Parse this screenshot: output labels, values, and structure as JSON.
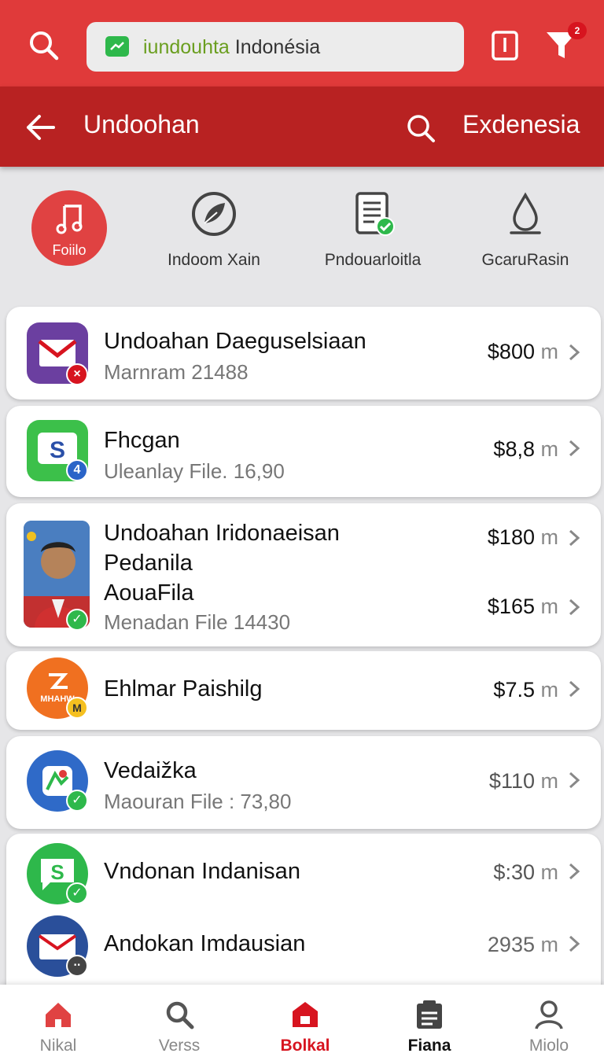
{
  "search": {
    "value_green": "iundouhta",
    "value_rest": " Indonésia"
  },
  "notifications": {
    "count": "2"
  },
  "header": {
    "title": "Undoohan",
    "action": "Exdenesia"
  },
  "categories": [
    {
      "label": "Foiilo",
      "icon": "music-note-icon",
      "active": true
    },
    {
      "label": "Indoom Xain",
      "icon": "leaf-circle-icon"
    },
    {
      "label": "Pndouarloitla",
      "icon": "document-check-icon"
    },
    {
      "label": "GcaruRasin",
      "icon": "droplet-icon"
    }
  ],
  "items": [
    {
      "title": "Undoahan Daeguselsiaan",
      "subtitle": "Marnram 21488",
      "price": "$800",
      "unit": "m",
      "icon": "mail-app-icon",
      "badge": "x"
    },
    {
      "title": "Fhcgan",
      "subtitle": "Uleanlay File. 16,90",
      "price": "$8,8",
      "unit": "m",
      "icon": "s-app-icon",
      "badge": "4"
    },
    {
      "title": "Undoahan Iridonaeisan",
      "title2": "Pedanila",
      "title3": "AouaFila",
      "subtitle": "Menadan File 14430",
      "price": "$180",
      "price2": "$165",
      "unit": "m",
      "icon": "profile-photo-icon",
      "badge": "check"
    },
    {
      "title": "Ehlmar Paishilg",
      "price": "$7.5",
      "unit": "m",
      "icon": "mhahw-app-icon",
      "badge": "M",
      "icon_text": "MHAHW"
    },
    {
      "title": "Vedaižka",
      "subtitle": "Maouran File : 73,80",
      "price": "$110",
      "unit": "m",
      "icon": "map-app-icon",
      "badge": "check"
    },
    {
      "title": "Vndonan Indanisan",
      "price": "$:30",
      "unit": "m",
      "icon": "message-s-app-icon",
      "badge": "check"
    },
    {
      "title": "Andokan Imdausian",
      "price": "2935",
      "unit": "m",
      "icon": "envelope-app-icon",
      "badge": "dots"
    }
  ],
  "nav": [
    {
      "label": "Nikal",
      "icon": "home-icon"
    },
    {
      "label": "Verss",
      "icon": "search-icon"
    },
    {
      "label": "Bolkal",
      "icon": "store-icon",
      "active": true
    },
    {
      "label": "Fiana",
      "icon": "clipboard-icon"
    },
    {
      "label": "Miolo",
      "icon": "person-icon"
    }
  ],
  "colors": {
    "primary": "#e03a3a",
    "header": "#b82222",
    "accent_green": "#2eb84b"
  }
}
